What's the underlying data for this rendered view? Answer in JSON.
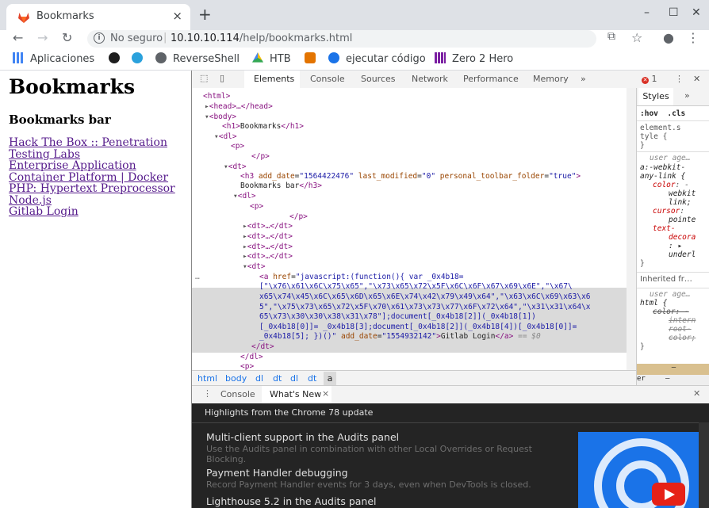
{
  "tab": {
    "title": "Bookmarks",
    "close": "×",
    "new_tab": "+"
  },
  "window": {
    "minimize": "–",
    "maximize": "☐",
    "close": "✕"
  },
  "toolbar": {
    "back": "←",
    "forward": "→",
    "reload": "↻",
    "security_text": "No seguro",
    "separator": "|",
    "url_host": "10.10.10.114",
    "url_path": "/help/bookmarks.html",
    "translate": "⧉",
    "star": "☆",
    "account": "●",
    "menu": "⋮"
  },
  "bookmarks_bar": [
    {
      "label": "Aplicaciones",
      "color": "#4285f4"
    },
    {
      "label": "",
      "color": "#1e1e1e"
    },
    {
      "label": "",
      "color": "#2aa1dc"
    },
    {
      "label": "ReverseShell",
      "color": "#5f6368"
    },
    {
      "label": "HTB",
      "color": "#fbbc04"
    },
    {
      "label": "",
      "color": "#e37400"
    },
    {
      "label": "ejecutar código",
      "color": "#1a73e8"
    },
    {
      "label": "Zero 2 Hero",
      "color": "#7b1fa2"
    }
  ],
  "page": {
    "h1": "Bookmarks",
    "h3": "Bookmarks bar",
    "links": [
      "Hack The Box :: Penetration Testing Labs",
      "Enterprise Application Container Platform | Docker",
      "PHP: Hypertext Preprocessor",
      "Node.js",
      "Gitlab Login"
    ]
  },
  "devtools": {
    "tabs": [
      "Elements",
      "Console",
      "Sources",
      "Network",
      "Performance",
      "Memory",
      "»"
    ],
    "error_count": "1",
    "more": "⋮",
    "close": "✕",
    "dom": {
      "html": "<html>",
      "head": "<head>…</head>",
      "body": "<body>",
      "h1_open": "<h1>",
      "h1_text": "Bookmarks",
      "h1_close": "</h1>",
      "dl": "<dl>",
      "p": "<p>",
      "p_close": "</p>",
      "dt": "<dt>",
      "h3_open": "<h3",
      "h3_attr1_name": "add_date",
      "h3_attr1_val": "\"1564422476\"",
      "h3_attr2_name": "last_modified",
      "h3_attr2_val": "\"0\"",
      "h3_attr3_name": "personal_toolbar_folder",
      "h3_attr3_val": "\"true\"",
      "h3_text": "Bookmarks bar",
      "h3_close": "</h3>",
      "dl2": "<dl>",
      "p2": "<p>",
      "p2_close": "</p>",
      "dt_collapsed": "<dt>…</dt>",
      "dt_open": "<dt>",
      "a_open": "<a",
      "href_name": "href",
      "href_l1": "\"javascript:(function(){ var _0x4b18=",
      "href_l2": "[\"\\x76\\x61\\x6C\\x75\\x65\",\"\\x73\\x65\\x72\\x5F\\x6C\\x6F\\x67\\x69\\x6E\",\"\\x67\\",
      "href_l3": "x65\\x74\\x45\\x6C\\x65\\x6D\\x65\\x6E\\x74\\x42\\x79\\x49\\x64\",\"\\x63\\x6C\\x69\\x63\\x6",
      "href_l4": "5\",\"\\x75\\x73\\x65\\x72\\x5F\\x70\\x61\\x73\\x73\\x77\\x6F\\x72\\x64\",\"\\x31\\x31\\x64\\x",
      "href_l5": "65\\x73\\x30\\x30\\x38\\x31\\x78\"];document[_0x4b18[2]](_0x4b18[1])",
      "href_l6": "[_0x4b18[0]]= _0x4b18[3];document[_0x4b18[2]](_0x4b18[4])[_0x4b18[0]]=",
      "href_l7": "_0x4b18[5]; })()\"",
      "a_date_name": "add_date",
      "a_date_val": "\"1554932142\"",
      "a_text": "Gitlab Login",
      "a_close": "</a>",
      "eq": "== $0",
      "dt_close": "</dt>",
      "dl_close": "</dl>",
      "p3": "<p>"
    },
    "breadcrumbs": [
      "html",
      "body",
      "dl",
      "dt",
      "dl",
      "dt",
      "a"
    ],
    "styles": {
      "tab": "Styles",
      "more": "»",
      "hov": ":hov",
      "cls": ".cls",
      "element_style": [
        "element.s",
        "tyle {",
        "}"
      ],
      "ua_label": "user age…",
      "ua_selector": [
        "a:-webkit-",
        "any-link {"
      ],
      "ua_props": [
        {
          "name": "color",
          "value": "-"
        },
        {
          "name": "",
          "value": "webkit"
        },
        {
          "name": "",
          "value": "link;"
        },
        {
          "name": "cursor",
          "value": ""
        },
        {
          "name": "",
          "value": "pointe"
        },
        {
          "name": "text-",
          "value": ""
        },
        {
          "name": "decora",
          "value": ""
        },
        {
          "name": "",
          "value": ": ▸"
        },
        {
          "name": "",
          "value": "underl"
        }
      ],
      "close_brace": "}",
      "inherited": "Inherited fr…",
      "ua_label2": "user age…",
      "html_selector": "html {",
      "html_props": [
        "color: -",
        "intern",
        "root-",
        "color;"
      ],
      "close_brace2": "}",
      "dash": "–",
      "er": "er"
    },
    "drawer": {
      "tabs": [
        "Console",
        "What's New"
      ],
      "close_tab": "×",
      "close": "✕",
      "header": "Highlights from the Chrome 78 update",
      "items": [
        {
          "title": "Multi-client support in the Audits panel",
          "desc": "Use the Audits panel in combination with other Local Overrides or Request Blocking."
        },
        {
          "title": "Payment Handler debugging",
          "desc": "Record Payment Handler events for 3 days, even when DevTools is closed."
        },
        {
          "title": "Lighthouse 5.2 in the Audits panel",
          "desc": ""
        }
      ]
    }
  }
}
